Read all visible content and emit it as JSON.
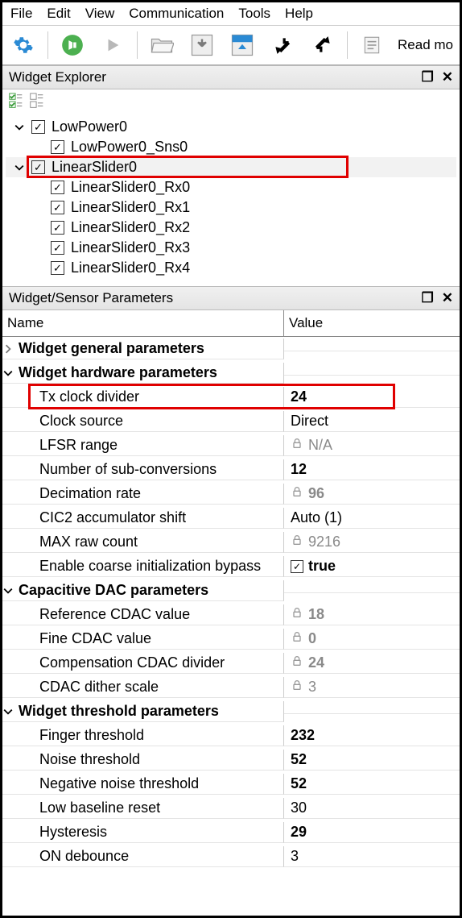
{
  "menu": {
    "items": [
      "File",
      "Edit",
      "View",
      "Communication",
      "Tools",
      "Help"
    ]
  },
  "toolbar": {
    "readmode": "Read mo"
  },
  "panels": {
    "explorer": {
      "title": "Widget Explorer"
    },
    "params": {
      "title": "Widget/Sensor Parameters"
    }
  },
  "tree": {
    "items": [
      {
        "label": "LowPower0",
        "level": 1,
        "arrow": "down"
      },
      {
        "label": "LowPower0_Sns0",
        "level": 2
      },
      {
        "label": "LinearSlider0",
        "level": 1,
        "arrow": "down",
        "selected": true
      },
      {
        "label": "LinearSlider0_Rx0",
        "level": 2
      },
      {
        "label": "LinearSlider0_Rx1",
        "level": 2
      },
      {
        "label": "LinearSlider0_Rx2",
        "level": 2
      },
      {
        "label": "LinearSlider0_Rx3",
        "level": 2
      },
      {
        "label": "LinearSlider0_Rx4",
        "level": 2
      }
    ]
  },
  "param_headers": {
    "name": "Name",
    "value": "Value"
  },
  "params": [
    {
      "type": "group",
      "arrow": "right",
      "label": "Widget general parameters"
    },
    {
      "type": "group",
      "arrow": "down",
      "label": "Widget hardware parameters"
    },
    {
      "type": "row",
      "label": "Tx clock divider",
      "value": "24",
      "bold": true,
      "highlight": true
    },
    {
      "type": "row",
      "label": "Clock source",
      "value": "Direct"
    },
    {
      "type": "row",
      "label": "LFSR range",
      "value": "N/A",
      "locked": true
    },
    {
      "type": "row",
      "label": "Number of sub-conversions",
      "value": "12",
      "bold": true
    },
    {
      "type": "row",
      "label": "Decimation rate",
      "value": "96",
      "locked": true,
      "bold": true
    },
    {
      "type": "row",
      "label": "CIC2 accumulator shift",
      "value": "Auto (1)"
    },
    {
      "type": "row",
      "label": "MAX raw count",
      "value": "9216",
      "locked": true
    },
    {
      "type": "row",
      "label": "Enable coarse initialization bypass",
      "value": "true",
      "checkbox": true,
      "bold": true
    },
    {
      "type": "group",
      "arrow": "down",
      "label": "Capacitive DAC parameters"
    },
    {
      "type": "row",
      "label": "Reference CDAC value",
      "value": "18",
      "locked": true,
      "bold": true
    },
    {
      "type": "row",
      "label": "Fine CDAC value",
      "value": "0",
      "locked": true,
      "bold": true
    },
    {
      "type": "row",
      "label": "Compensation CDAC divider",
      "value": "24",
      "locked": true,
      "bold": true
    },
    {
      "type": "row",
      "label": "CDAC dither scale",
      "value": "3",
      "locked": true
    },
    {
      "type": "group",
      "arrow": "down",
      "label": "Widget threshold parameters"
    },
    {
      "type": "row",
      "label": "Finger threshold",
      "value": "232",
      "bold": true
    },
    {
      "type": "row",
      "label": "Noise threshold",
      "value": "52",
      "bold": true
    },
    {
      "type": "row",
      "label": "Negative noise threshold",
      "value": "52",
      "bold": true
    },
    {
      "type": "row",
      "label": "Low baseline reset",
      "value": "30"
    },
    {
      "type": "row",
      "label": "Hysteresis",
      "value": "29",
      "bold": true
    },
    {
      "type": "row",
      "label": "ON debounce",
      "value": "3"
    }
  ]
}
